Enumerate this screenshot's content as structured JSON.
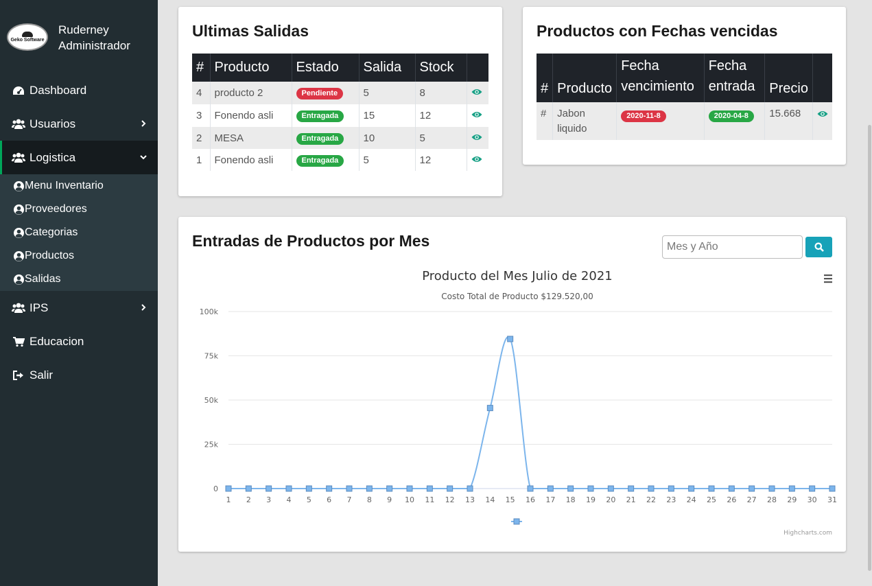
{
  "user": {
    "logo_text": "Geko Software",
    "name_line1": "Ruderney",
    "name_line2": "Administrador"
  },
  "sidebar": {
    "items": [
      {
        "label": "Dashboard",
        "icon": "dashboard-icon"
      },
      {
        "label": "Usuarios",
        "icon": "users-icon"
      },
      {
        "label": "Logistica",
        "icon": "users-icon"
      },
      {
        "label": "IPS",
        "icon": "users-icon"
      },
      {
        "label": "Educacion",
        "icon": "cart-icon"
      },
      {
        "label": "Salir",
        "icon": "sign-out-icon"
      }
    ],
    "submenu": [
      {
        "label": "Menu Inventario"
      },
      {
        "label": "Proveedores"
      },
      {
        "label": "Categorias"
      },
      {
        "label": "Productos"
      },
      {
        "label": "Salidas"
      }
    ]
  },
  "salidas": {
    "title": "Ultimas Salidas",
    "headers": [
      "#",
      "Producto",
      "Estado",
      "Salida",
      "Stock",
      ""
    ],
    "rows": [
      {
        "id": "4",
        "producto": "producto 2",
        "estado": "Pendiente",
        "salida": "5",
        "stock": "8"
      },
      {
        "id": "3",
        "producto": "Fonendo asli",
        "estado": "Entragada",
        "salida": "15",
        "stock": "12"
      },
      {
        "id": "2",
        "producto": "MESA",
        "estado": "Entragada",
        "salida": "10",
        "stock": "5"
      },
      {
        "id": "1",
        "producto": "Fonendo asli",
        "estado": "Entragada",
        "salida": "5",
        "stock": "12"
      }
    ]
  },
  "vencidos": {
    "title": "Productos con Fechas vencidas",
    "headers": {
      "num": "#",
      "producto": "Producto",
      "fecha_v1": "Fecha",
      "fecha_v2": "vencimiento",
      "fecha_e1": "Fecha",
      "fecha_e2": "entrada",
      "precio": "Precio"
    },
    "rows": [
      {
        "id": "#",
        "producto_l1": "Jabon",
        "producto_l2": "liquido",
        "fecha_vencimiento": "2020-11-8",
        "fecha_entrada": "2020-04-8",
        "precio": "15.668"
      }
    ]
  },
  "entradas": {
    "title": "Entradas de Productos por Mes",
    "search_placeholder": "Mes y Año",
    "credits": "Highcharts.com"
  },
  "colors": {
    "sidebar": "#222d32",
    "accent": "#00a65a",
    "line": "#7cb5ec",
    "badge_red": "#dc3545",
    "badge_green": "#28a745",
    "search_btn": "#17a2b8"
  },
  "chart_data": {
    "type": "line",
    "title": "Producto del Mes Julio de 2021",
    "subtitle": "Costo Total de Producto $129.520,00",
    "xlabel": "",
    "ylabel": "",
    "x": [
      1,
      2,
      3,
      4,
      5,
      6,
      7,
      8,
      9,
      10,
      11,
      12,
      13,
      14,
      15,
      16,
      17,
      18,
      19,
      20,
      21,
      22,
      23,
      24,
      25,
      26,
      27,
      28,
      29,
      30,
      31
    ],
    "series": [
      {
        "values": [
          0,
          0,
          0,
          0,
          0,
          0,
          0,
          0,
          0,
          0,
          0,
          0,
          0,
          45500,
          84500,
          0,
          0,
          0,
          0,
          0,
          0,
          0,
          0,
          0,
          0,
          0,
          0,
          0,
          0,
          0,
          0
        ]
      }
    ],
    "ylim": [
      0,
      100000
    ],
    "yticks": [
      {
        "value": 0,
        "label": "0"
      },
      {
        "value": 25000,
        "label": "25k"
      },
      {
        "value": 50000,
        "label": "50k"
      },
      {
        "value": 75000,
        "label": "75k"
      },
      {
        "value": 100000,
        "label": "100k"
      }
    ],
    "grid": true,
    "legend": "bottom-center"
  }
}
